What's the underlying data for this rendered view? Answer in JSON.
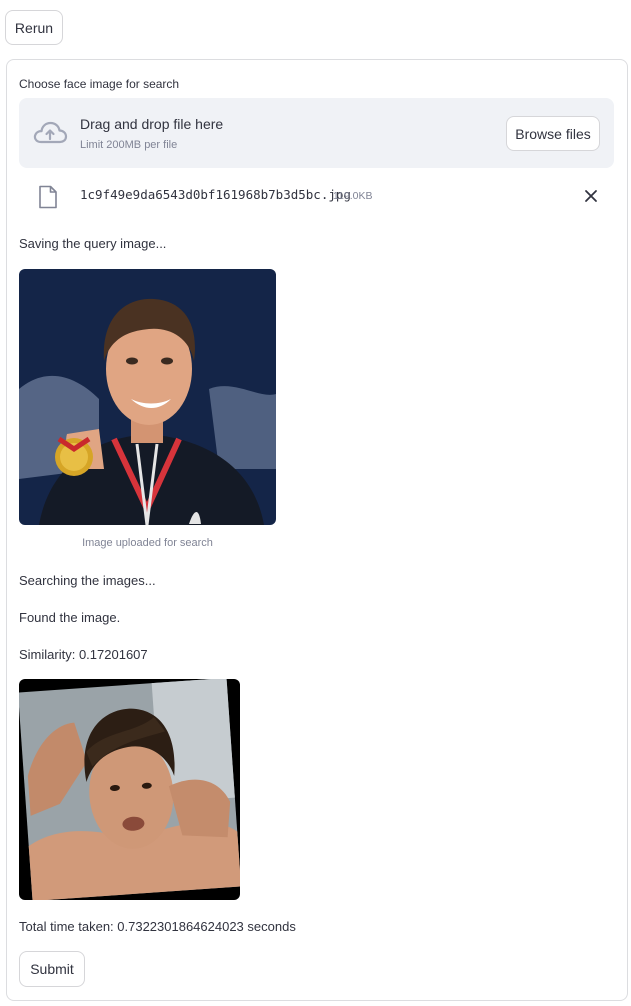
{
  "header": {
    "rerun_label": "Rerun"
  },
  "uploader": {
    "label": "Choose face image for search",
    "drop_title": "Drag and drop file here",
    "drop_limit": "Limit 200MB per file",
    "browse_label": "Browse files",
    "cloud_icon": "cloud-upload-icon",
    "file": {
      "icon": "file-icon",
      "name": "1c9f49e9da6543d0bf161968b7b3d5bc.jpg",
      "size": "119.0KB",
      "remove_icon": "close-icon"
    }
  },
  "status": {
    "saving": "Saving the query image...",
    "searching": "Searching the images...",
    "found": "Found the image.",
    "similarity": "Similarity: 0.17201607",
    "total_time": "Total time taken: 0.7322301864624023 seconds"
  },
  "query_image": {
    "caption": "Image uploaded for search"
  },
  "form": {
    "submit_label": "Submit"
  },
  "colors": {
    "dropzone_bg": "#f0f2f6",
    "text": "#31333f",
    "muted": "#808495",
    "border": "#d6d6d9"
  }
}
